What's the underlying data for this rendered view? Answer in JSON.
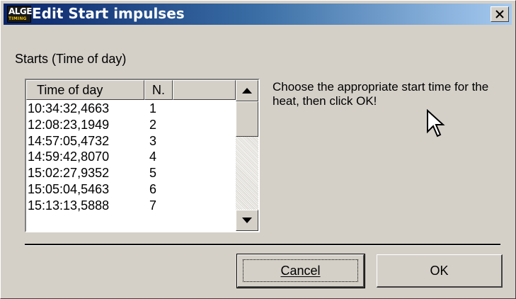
{
  "window": {
    "title": "Edit Start impulses",
    "logo_top": "ALGE",
    "logo_bottom": "TIMING"
  },
  "group_label": "Starts (Time of day)",
  "list": {
    "columns": [
      "Time of day",
      "N."
    ],
    "rows": [
      {
        "time": "10:34:32,4663",
        "n": "1"
      },
      {
        "time": "12:08:23,1949",
        "n": "2"
      },
      {
        "time": "14:57:05,4732",
        "n": "3"
      },
      {
        "time": "14:59:42,8070",
        "n": "4"
      },
      {
        "time": "15:02:27,9352",
        "n": "5"
      },
      {
        "time": "15:05:04,5463",
        "n": "6"
      },
      {
        "time": "15:13:13,5888",
        "n": "7"
      }
    ]
  },
  "instructions": "Choose the appropriate start time for the heat, then click OK!",
  "buttons": {
    "cancel": "Cancel",
    "ok": "OK"
  },
  "icons": {
    "close": "close-icon",
    "scroll_up": "arrow-up-icon",
    "scroll_down": "arrow-down-icon",
    "cursor": "mouse-pointer-icon"
  }
}
